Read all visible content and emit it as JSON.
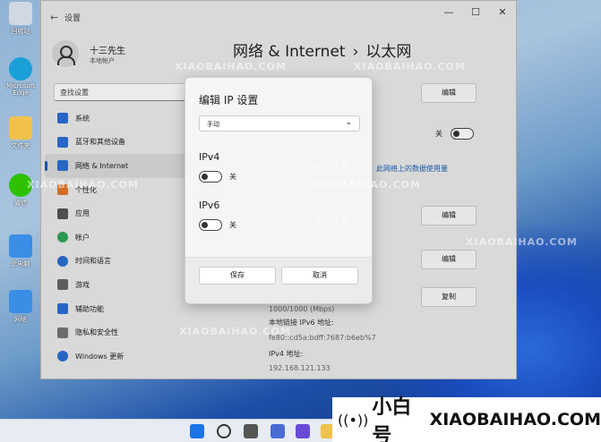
{
  "desktop": {
    "icons": [
      {
        "label": "回收站",
        "color": "#cfd8e3"
      },
      {
        "label": "Microsoft Edge",
        "color": "#1aa0d8"
      },
      {
        "label": "文件夹",
        "color": "#f1c24b"
      },
      {
        "label": "微信",
        "color": "#2dc100"
      },
      {
        "label": "此电脑",
        "color": "#3a8ee6"
      },
      {
        "label": "网络",
        "color": "#3a8ee6"
      }
    ]
  },
  "window": {
    "title": "设置",
    "back_glyph": "←",
    "controls": {
      "minimize": "—",
      "maximize": "☐",
      "close": "✕"
    },
    "user": {
      "name": "十三先生",
      "account": "本地帐户"
    },
    "search_placeholder": "查找设置",
    "search_glyph": "⌕",
    "nav": [
      {
        "label": "系统",
        "color": "#2b6fd6"
      },
      {
        "label": "蓝牙和其他设备",
        "color": "#2b6fd6"
      },
      {
        "label": "网络 & Internet",
        "color": "#2b6fd6",
        "active": true
      },
      {
        "label": "个性化",
        "color": "#e07a2e"
      },
      {
        "label": "应用",
        "color": "#555"
      },
      {
        "label": "帐户",
        "color": "#2da55a"
      },
      {
        "label": "时间和语言",
        "color": "#2b6fd6"
      },
      {
        "label": "游戏",
        "color": "#666"
      },
      {
        "label": "辅助功能",
        "color": "#2b6fd6"
      },
      {
        "label": "隐私和安全性",
        "color": "#777"
      },
      {
        "label": "Windows 更新",
        "color": "#2b6fd6"
      }
    ],
    "breadcrumb": {
      "parent": "网络 & Internet",
      "separator": "›",
      "current": "以太网"
    },
    "content": {
      "edit_label": "编辑",
      "copy_label": "复制",
      "toggle_off": "关",
      "data_link": "此网络上的数据使用量",
      "speed": "1000/1000 (Mbps)",
      "ipv6_link_local_label": "本地链接 IPv6 地址:",
      "ipv6_link_local_value": "fe80::cd5a:bdff:7687:b6eb%7",
      "ipv4_label": "IPv4 地址:",
      "ipv4_value": "192.168.121.133"
    }
  },
  "dialog": {
    "title": "编辑 IP 设置",
    "mode_value": "手动",
    "chevron": "⌄",
    "ipv4_label": "IPv4",
    "ipv4_state": "关",
    "ipv6_label": "IPv6",
    "ipv6_state": "关",
    "save_label": "保存",
    "cancel_label": "取消"
  },
  "watermark": {
    "text": "XIAOBAIHAO.COM",
    "sub": "@小白号",
    "brand_wave": "((•))",
    "brand_cn": "小白号",
    "brand_en": "XIAOBAIHAO.COM"
  }
}
